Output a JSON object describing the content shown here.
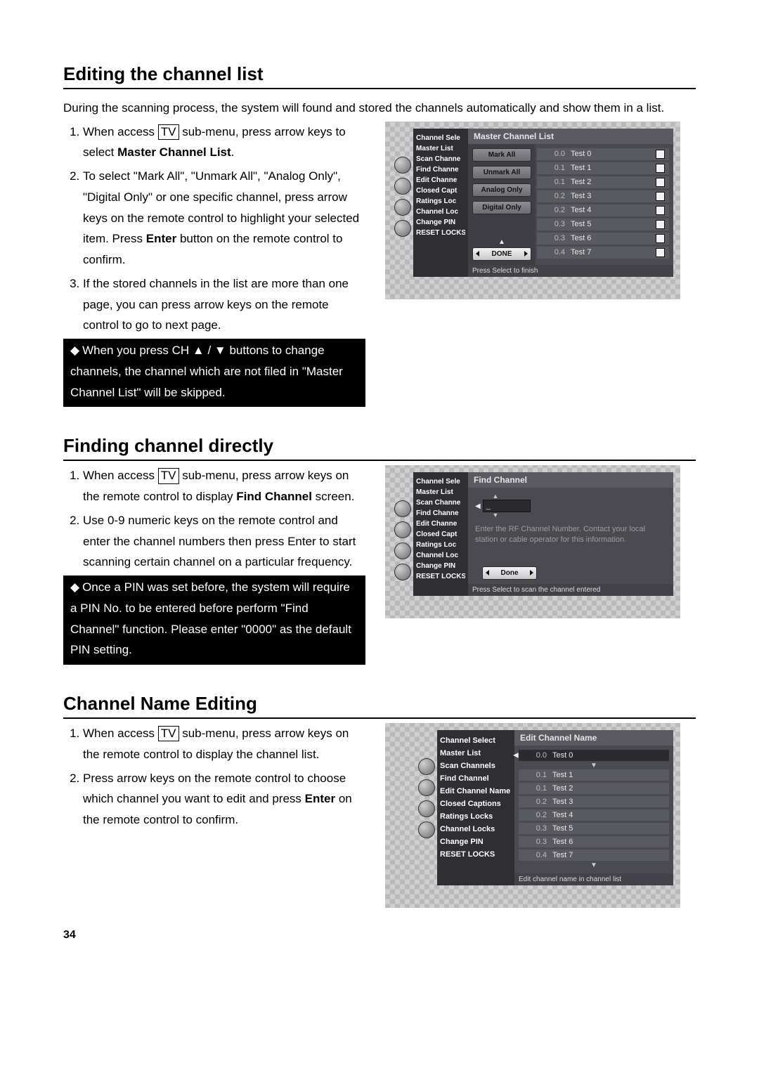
{
  "page_number": "34",
  "section1": {
    "title": "Editing the channel list",
    "intro": "During the scanning process, the system will found and stored the channels automatically and show them in a list.",
    "step1_a": "When access ",
    "tv": "TV",
    "step1_b": " sub-menu, press arrow keys to select ",
    "step1_bold": "Master Channel List",
    "step1_c": ".",
    "step2_a": "To select \"Mark All\", \"Unmark All\", \"Analog Only\", \"Digital Only\" or one specific channel, press arrow keys on the remote control to highlight your selected item. Press ",
    "step2_bold": "Enter",
    "step2_b": " button on the remote control to confirm.",
    "step3": "If the stored channels in the list are more than one page, you can press arrow keys on the remote control to go to next page.",
    "note": "When you press CH ▲ / ▼ buttons to change channels, the channel which are not filed in \"Master Channel List\" will be skipped."
  },
  "osd1": {
    "title": "Master Channel List",
    "sidemenu": [
      "Channel Sele",
      "Master List",
      "Scan Channe",
      "Find Channe",
      "Edit Channe",
      "Closed Capt",
      "Ratings Loc",
      "Channel Loc",
      "Change PIN",
      "RESET LOCKS"
    ],
    "actions": [
      "Mark All",
      "Unmark All",
      "Analog Only",
      "Digital Only"
    ],
    "done": "DONE",
    "channels": [
      {
        "num": "0.0",
        "name": "Test 0"
      },
      {
        "num": "0.1",
        "name": "Test 1"
      },
      {
        "num": "0.1",
        "name": "Test 2"
      },
      {
        "num": "0.2",
        "name": "Test 3"
      },
      {
        "num": "0.2",
        "name": "Test 4"
      },
      {
        "num": "0.3",
        "name": "Test 5"
      },
      {
        "num": "0.3",
        "name": "Test 6"
      },
      {
        "num": "0.4",
        "name": "Test 7"
      }
    ],
    "status": "Press Select to finish"
  },
  "section2": {
    "title": "Finding channel directly",
    "step1_a": "When access ",
    "step1_b": " sub-menu, press arrow keys on the remote control to display ",
    "step1_bold": "Find Channel",
    "step1_c": " screen.",
    "step2": "Use 0-9 numeric keys on the remote control and enter the channel numbers then press Enter to start scanning certain channel on a particular frequency.",
    "note": "Once a PIN was set before, the system will require a PIN No. to be entered before perform \"Find Channel\" function. Please enter \"0000\" as the default PIN setting."
  },
  "osd2": {
    "title": "Find Channel",
    "sidemenu": [
      "Channel Sele",
      "Master List",
      "Scan Channe",
      "Find Channe",
      "Edit Channe",
      "Closed Capt",
      "Ratings Loc",
      "Channel Loc",
      "Change PIN",
      "RESET LOCKS"
    ],
    "input": "_",
    "desc": "Enter the RF Channel Number. Contact your local station or cable operator for this information.",
    "done": "Done",
    "status": "Press Select to scan the channel entered"
  },
  "section3": {
    "title": "Channel Name Editing",
    "step1_a": "When access ",
    "step1_b": " sub-menu, press arrow keys on the remote control to display the channel list.",
    "step2_a": "Press arrow keys on the remote control to choose which channel you want to edit and press ",
    "step2_bold": "Enter",
    "step2_b": " on the remote control to confirm."
  },
  "osd3": {
    "title": "Edit Channel Name",
    "sidemenu": [
      "Channel Select",
      "Master List",
      "Scan Channels",
      "Find Channel",
      "Edit Channel Name",
      "Closed Captions",
      "Ratings Locks",
      "Channel Locks",
      "Change PIN",
      "RESET LOCKS"
    ],
    "channels": [
      {
        "num": "0.0",
        "name": "Test 0"
      },
      {
        "num": "0.1",
        "name": "Test 1"
      },
      {
        "num": "0.1",
        "name": "Test 2"
      },
      {
        "num": "0.2",
        "name": "Test 3"
      },
      {
        "num": "0.2",
        "name": "Test 4"
      },
      {
        "num": "0.3",
        "name": "Test 5"
      },
      {
        "num": "0.3",
        "name": "Test 6"
      },
      {
        "num": "0.4",
        "name": "Test 7"
      }
    ],
    "status": "Edit channel name in channel list"
  }
}
